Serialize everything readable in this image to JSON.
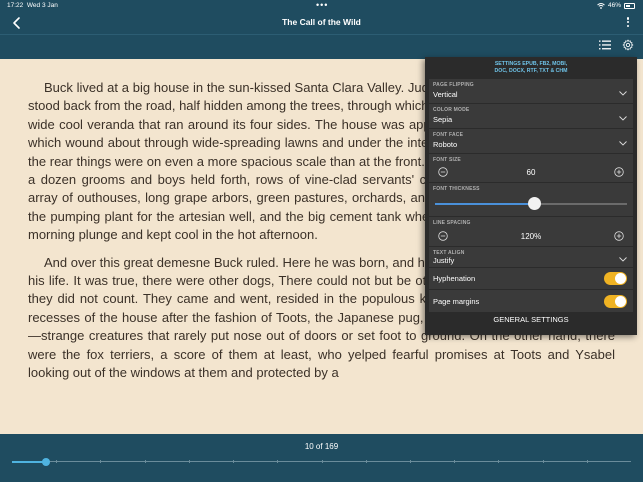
{
  "status": {
    "time": "17:22",
    "date": "Wed 3 Jan",
    "battery": "46%"
  },
  "header": {
    "title": "The Call of the Wild",
    "back_icon": "chevron-left-icon",
    "more_icon": "more-vertical-icon",
    "toc_icon": "list-icon",
    "settings_icon": "gear-icon"
  },
  "content": {
    "paragraphs": [
      "Buck lived at a big house in the sun-kissed Santa Clara Valley. Judge Miller's place, it was called. It stood back from the road, half hidden among the trees, through which glimpses could be caught of the wide cool veranda that ran around its four sides. The house was approached by gravelled driveways which wound about through wide-spreading lawns and under the interlacing boughs of tall poplars. At the rear things were on even a more spacious scale than at the front. There were great stables, where a dozen grooms and boys held forth, rows of vine-clad servants' cottages, an endless and orderly array of outhouses, long grape arbors, green pastures, orchards, and berry patches. Then there was the pumping plant for the artesian well, and the big cement tank where Judge Miller's boys took their morning plunge and kept cool in the hot afternoon.",
      "And over this great demesne Buck ruled. Here he was born, and here he had lived the four years of his life. It was true, there were other dogs, There could not but be other dogs on so vast a place, but they did not count. They came and went, resided in the populous kennels, or lived obscurely in the recesses of the house after the fashion of Toots, the Japanese pug, or Ysabel, the Mexican hairless,—strange creatures that rarely put nose out of doors or set foot to ground. On the other hand, there were the fox terriers, a score of them at least, who yelped fearful promises at Toots and Ysabel looking out of the windows at them and protected by a"
    ]
  },
  "settings": {
    "header_line1": "SETTINGS EPUB, FB2, MOBI,",
    "header_line2": "DOC, DOCX, RTF, TXT & CHM",
    "page_flipping": {
      "label": "PAGE FLIPPING",
      "value": "Vertical"
    },
    "color_mode": {
      "label": "COLOR MODE",
      "value": "Sepia"
    },
    "font_face": {
      "label": "FONT FACE",
      "value": "Roboto"
    },
    "font_size": {
      "label": "FONT SIZE",
      "value": "60"
    },
    "font_thickness": {
      "label": "FONT THICKNESS",
      "value": 0.52
    },
    "line_spacing": {
      "label": "LINE SPACING",
      "value": "120%"
    },
    "text_align": {
      "label": "TEXT ALIGN",
      "value": "Justify"
    },
    "hyphenation": {
      "label": "Hyphenation",
      "on": true
    },
    "page_margins": {
      "label": "Page margins",
      "on": true
    },
    "general_button": "GENERAL SETTINGS"
  },
  "footer": {
    "page_indicator": "10 of 169",
    "progress": 0.055
  },
  "colors": {
    "chrome": "#1f4c60",
    "sepia_background": "#f3e5cf",
    "accent": "#4fb3e0",
    "toggle_on": "#f0b323",
    "panel": "#2b2b2b"
  }
}
